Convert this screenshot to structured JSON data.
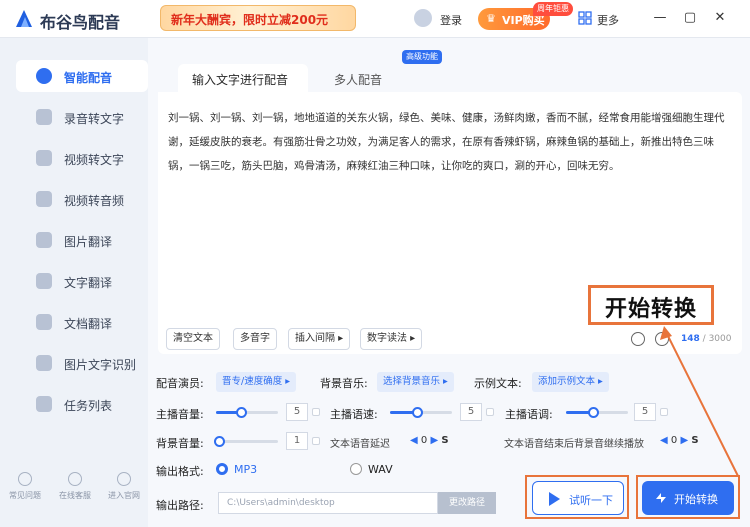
{
  "app": {
    "title": "布谷鸟配音",
    "promo_text": "新年大酬宾，限时立减200元",
    "login": "登录",
    "vip_label": "VIP购买",
    "vip_badge": "周年钜惠",
    "more": "更多",
    "icons": {
      "logo": "bird-logo-icon",
      "user": "user-icon",
      "more": "grid-icon"
    }
  },
  "sidebar": {
    "items": [
      {
        "label": "智能配音",
        "active": true,
        "icon": "smart-dub-icon"
      },
      {
        "label": "录音转文字",
        "active": false,
        "icon": "audio-to-text-icon"
      },
      {
        "label": "视频转文字",
        "active": false,
        "icon": "video-to-text-icon"
      },
      {
        "label": "视频转音频",
        "active": false,
        "icon": "video-to-audio-icon"
      },
      {
        "label": "图片翻译",
        "active": false,
        "icon": "image-translate-icon"
      },
      {
        "label": "文字翻译",
        "active": false,
        "icon": "text-translate-icon"
      },
      {
        "label": "文档翻译",
        "active": false,
        "icon": "doc-translate-icon"
      },
      {
        "label": "图片文字识别",
        "active": false,
        "icon": "ocr-icon"
      },
      {
        "label": "任务列表",
        "active": false,
        "icon": "task-list-icon"
      }
    ],
    "footer": [
      "常见问题",
      "在线客服",
      "进入官网"
    ]
  },
  "tabs": {
    "active": "输入文字进行配音",
    "other": "多人配音",
    "badge": "高级功能"
  },
  "editor": {
    "text": "刘一锅、刘一锅、刘一锅，地地道道的关东火锅，绿色、美味、健康，汤鲜肉嫩，香而不腻，经常食用能增强细胞生理代谢，延缓皮肤的衰老。有强筋壮骨之功效，为满足客人的需求，在原有香辣虾锅，麻辣鱼锅的基础上，新推出特色三味锅，一锅三吃，筋头巴脑，鸡骨清汤，麻辣红油三种口味，让你吃的爽口，涮的开心，回味无穷。",
    "tools": [
      "清空文本",
      "多音字",
      "插入间隔 ▸",
      "数字读法 ▸"
    ],
    "count": "148",
    "max": "/ 3000"
  },
  "settings": {
    "voice_label": "配音演员:",
    "voice_value": "晋专/速度确度 ▸",
    "bgm_label": "背景音乐:",
    "bgm_value": "选择背景音乐 ▸",
    "sample_label": "示例文本:",
    "sample_value": "添加示例文本 ▸",
    "volume_label": "主播音量:",
    "volume_value": "5",
    "speed_label": "主播语速:",
    "speed_value": "5",
    "pitch_label": "主播语调:",
    "pitch_value": "5",
    "bg_volume_label": "背景音量:",
    "bg_volume_value": "1",
    "delay_label": "文本语音延迟",
    "delay_value": "0",
    "delay_unit": "S",
    "tail_label": "文本语音结束后背景音继续播放",
    "tail_value": "0",
    "tail_unit": "S",
    "format_label": "输出格式:",
    "format_options": [
      "MP3",
      "WAV"
    ],
    "format_selected": "MP3",
    "path_label": "输出路径:",
    "path_value": "C:\\Users\\admin\\desktop",
    "path_button": "更改路径",
    "volume_levels": {
      "volume": 0.4,
      "speed": 0.45,
      "pitch": 0.45,
      "bg_volume": 0.0
    }
  },
  "actions": {
    "try": "试听一下",
    "start": "开始转换",
    "callout": "开始转换"
  },
  "colors": {
    "accent": "#2f6ef0",
    "highlight": "#e8743b",
    "promo_text": "#e02d1b"
  }
}
